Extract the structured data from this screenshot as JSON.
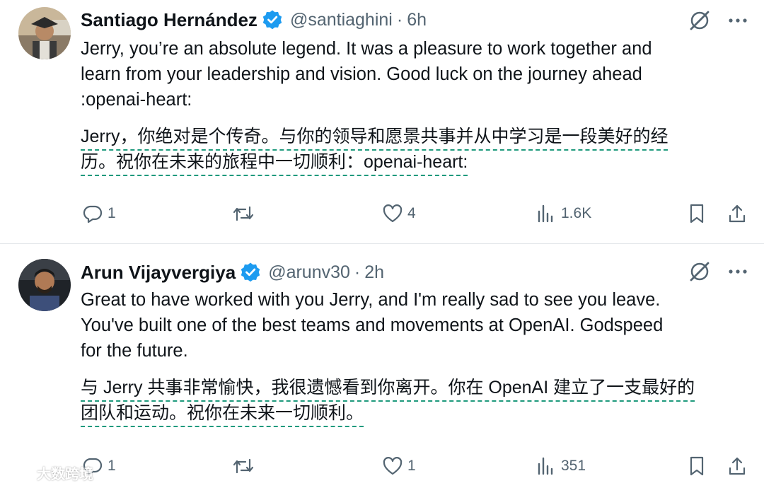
{
  "tweets": [
    {
      "author_name": "Santiago Hernández",
      "handle": "@santiaghini",
      "separator": "·",
      "time": "6h",
      "text_lines": [
        "Jerry, you’re an absolute legend. It was a pleasure to work together and",
        "learn from your leadership and vision. Good luck on the journey ahead",
        ":openai-heart:"
      ],
      "translation_lines": [
        "Jerry，你绝对是个传奇。与你的领导和愿景共事并从中学习是一段美好的经",
        "历。祝你在未来的旅程中一切顺利：openai-heart:"
      ],
      "replies": "1",
      "likes": "4",
      "views": "1.6K"
    },
    {
      "author_name": "Arun Vijayvergiya",
      "handle": "@arunv30",
      "separator": "·",
      "time": "2h",
      "text_lines": [
        "Great to have worked with you Jerry, and I'm really sad to see you leave.",
        "You've built one of the best teams and movements at OpenAI. Godspeed",
        "for the future."
      ],
      "translation_lines": [
        "与 Jerry 共事非常愉快，我很遗憾看到你离开。你在 OpenAI 建立了一支最好的",
        "团队和运动。祝你在未来一切顺利。"
      ],
      "replies": "1",
      "likes": "1",
      "views": "351"
    }
  ],
  "icons": {
    "verified": "verified-badge-icon",
    "grok": "grok-slash-icon",
    "more": "more-dots-icon",
    "reply": "reply-icon",
    "retweet": "retweet-icon",
    "like": "heart-icon",
    "views": "views-bar-icon",
    "bookmark": "bookmark-icon",
    "share": "share-icon"
  },
  "colors": {
    "verified": "#1d9bf0",
    "muted": "#536471",
    "translation_underline": "#1f9a7d"
  },
  "watermark": "大数跨境"
}
